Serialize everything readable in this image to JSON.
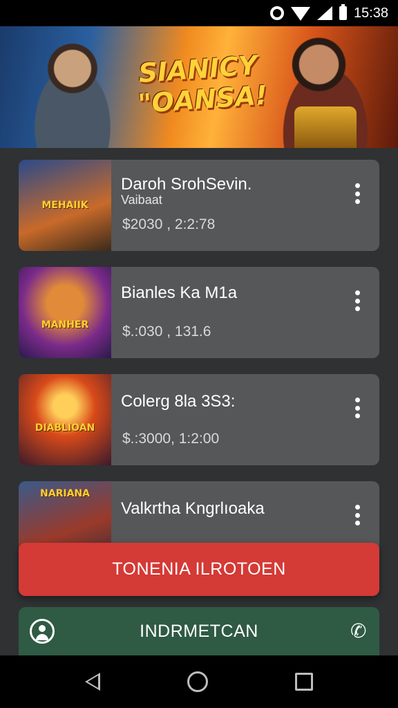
{
  "status_bar": {
    "time": "15:38",
    "icons": [
      "settings-icon",
      "wifi-icon",
      "signal-icon",
      "battery-icon"
    ]
  },
  "banner": {
    "title_line1": "SIANICY",
    "title_line2": "\"OANSA!"
  },
  "cards": [
    {
      "title": "Daroh SrohSevin.",
      "subtitle": "Vaibaat",
      "price": "$2030 ,  2:2:78",
      "thumb_text": "MEHAIIK"
    },
    {
      "title": "Bianles Ka M1a",
      "subtitle": "",
      "price": "$.:030 , 131.6",
      "thumb_text": "MANHER"
    },
    {
      "title": "Colerg 8la 3S3:",
      "subtitle": "",
      "price": "$.:3000, 1:2:00",
      "thumb_text": "DIABLIOAN"
    },
    {
      "title": "Valkrtha Kngrlıoaka",
      "subtitle": "",
      "price": "",
      "thumb_text": "NARIANA"
    }
  ],
  "buttons": {
    "primary_label": "TONENIA ILROTOEN",
    "secondary_label": "INDRMETCAN"
  },
  "colors": {
    "primary": "#d43a36",
    "secondary": "#2f5a44",
    "card": "#555759",
    "background": "#2f3133"
  }
}
